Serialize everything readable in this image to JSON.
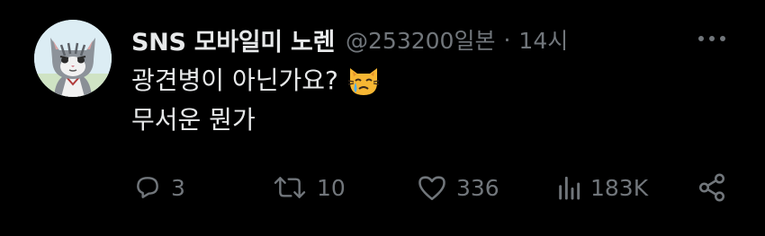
{
  "tweet": {
    "display_name": "SNS 모바일미 노렌",
    "handle": "@253200일본",
    "separator": "·",
    "time": "14시",
    "text_line1": "광견병이 아닌가요?",
    "text_line2": "무서운 뭔가",
    "emoji": "crying-cat-face"
  },
  "actions": {
    "reply_count": "3",
    "retweet_count": "10",
    "like_count": "336",
    "view_count": "183K"
  },
  "colors": {
    "background": "#000000",
    "primary_text": "#e7e9ea",
    "secondary_text": "#71767b"
  }
}
